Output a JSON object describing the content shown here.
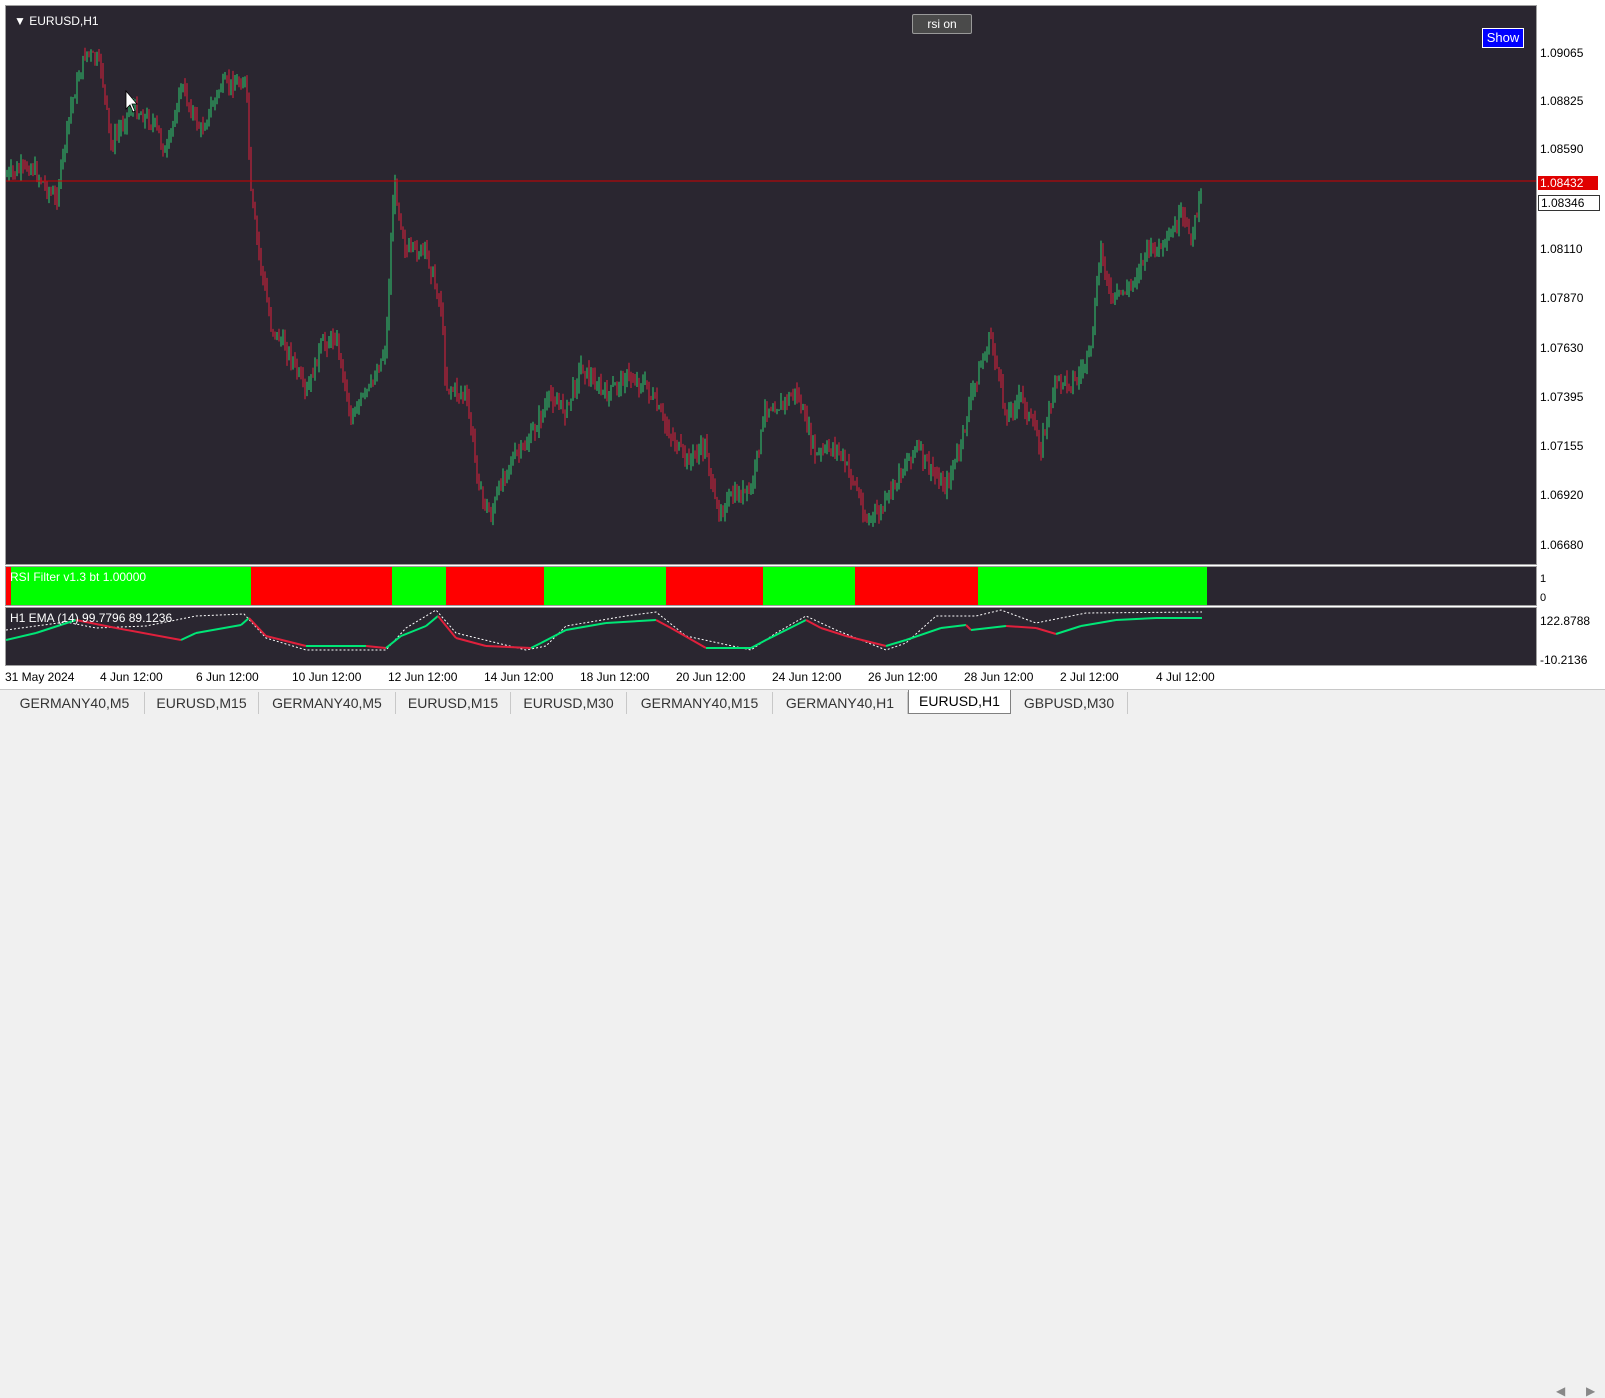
{
  "chart": {
    "symbol": "EURUSD,H1",
    "rsi_button": "rsi on",
    "show_button": "Show",
    "current_price": "1.08432",
    "bid_price": "1.08346",
    "price_line_color": "#d00000",
    "up_color": "#2ecc71",
    "down_color": "#e0203c"
  },
  "price_axis": [
    "1.09065",
    "1.08825",
    "1.08590",
    "1.08110",
    "1.07870",
    "1.07630",
    "1.07395",
    "1.07155",
    "1.06920",
    "1.06680"
  ],
  "time_axis": [
    "31 May 2024",
    "4 Jun 12:00",
    "6 Jun 12:00",
    "10 Jun 12:00",
    "12 Jun 12:00",
    "14 Jun 12:00",
    "18 Jun 12:00",
    "20 Jun 12:00",
    "24 Jun 12:00",
    "26 Jun 12:00",
    "28 Jun 12:00",
    "2 Jul 12:00",
    "4 Jul 12:00"
  ],
  "rsi_filter": {
    "label": "RSI Filter v1.3 bt 1.00000",
    "scale_top": "1",
    "scale_bottom": "0",
    "segments": [
      {
        "state": "up"
      },
      {
        "state": "down"
      },
      {
        "state": "up"
      },
      {
        "state": "down"
      },
      {
        "state": "up"
      },
      {
        "state": "down"
      },
      {
        "state": "up"
      },
      {
        "state": "down"
      },
      {
        "state": "up"
      }
    ]
  },
  "ema": {
    "label": "H1 EMA (14) 99.7796 89.1236",
    "scale_top": "122.8788",
    "scale_bottom": "-10.2136",
    "scale_bottom2": "0.00"
  },
  "tabs": [
    {
      "label": "GERMANY40,M5",
      "active": false
    },
    {
      "label": "EURUSD,M15",
      "active": false
    },
    {
      "label": "GERMANY40,M5",
      "active": false
    },
    {
      "label": "EURUSD,M15",
      "active": false
    },
    {
      "label": "EURUSD,M30",
      "active": false
    },
    {
      "label": "GERMANY40,M15",
      "active": false
    },
    {
      "label": "GERMANY40,H1",
      "active": false
    },
    {
      "label": "EURUSD,H1",
      "active": true
    },
    {
      "label": "GBPUSD,M30",
      "active": false
    }
  ]
}
